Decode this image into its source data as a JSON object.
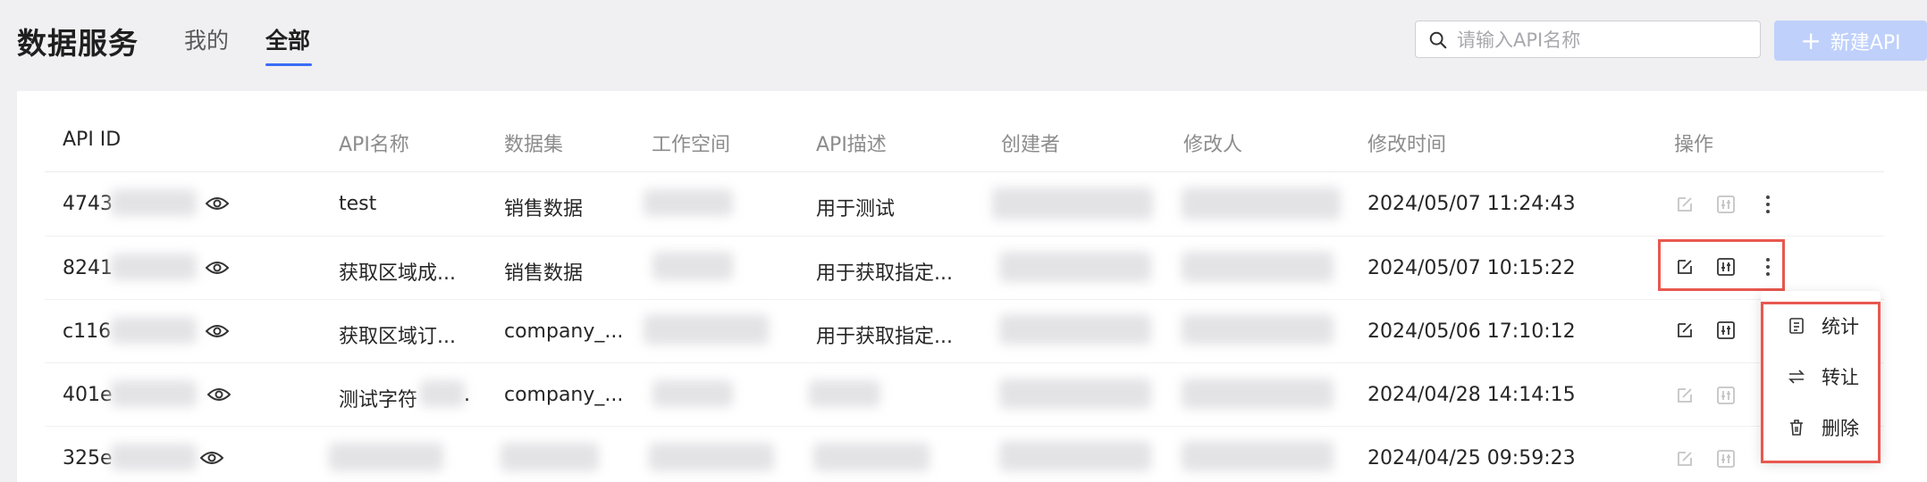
{
  "header": {
    "title": "数据服务",
    "tabs": [
      {
        "label": "我的",
        "active": false
      },
      {
        "label": "全部",
        "active": true
      }
    ],
    "search_placeholder": "请输入API名称",
    "new_button_label": "新建API"
  },
  "table": {
    "columns": [
      "API ID",
      "API名称",
      "数据集",
      "工作空间",
      "API描述",
      "创建者",
      "修改人",
      "修改时间",
      "操作"
    ],
    "rows": [
      {
        "id": "4743",
        "name": "test",
        "dataset": "销售数据",
        "description": "用于测试",
        "modified": "2024/05/07 11:24:43",
        "actions_active": false
      },
      {
        "id": "8241",
        "name": "获取区域成...",
        "dataset": "销售数据",
        "description": "用于获取指定...",
        "modified": "2024/05/07 10:15:22",
        "actions_active": true
      },
      {
        "id": "c116",
        "name": "获取区域订...",
        "dataset": "company_...",
        "description": "用于获取指定...",
        "modified": "2024/05/06 17:10:12",
        "actions_active": true
      },
      {
        "id": "401e",
        "name": "测试字符",
        "name_suffix": ".",
        "dataset": "company_...",
        "description": "",
        "modified": "2024/04/28 14:14:15",
        "actions_active": false
      },
      {
        "id": "325e",
        "name": "",
        "dataset": "",
        "description": "",
        "modified": "2024/04/25 09:59:23",
        "actions_active": false
      }
    ]
  },
  "dropdown_menu": {
    "items": [
      {
        "label": "统计",
        "icon": "stats-icon"
      },
      {
        "label": "转让",
        "icon": "transfer-icon"
      },
      {
        "label": "删除",
        "icon": "trash-icon"
      }
    ]
  },
  "colors": {
    "accent": "#3b6cf5",
    "primary_button_disabled": "#bfd0fb",
    "highlight": "#e8584f",
    "page_background": "#f0f0f2"
  }
}
